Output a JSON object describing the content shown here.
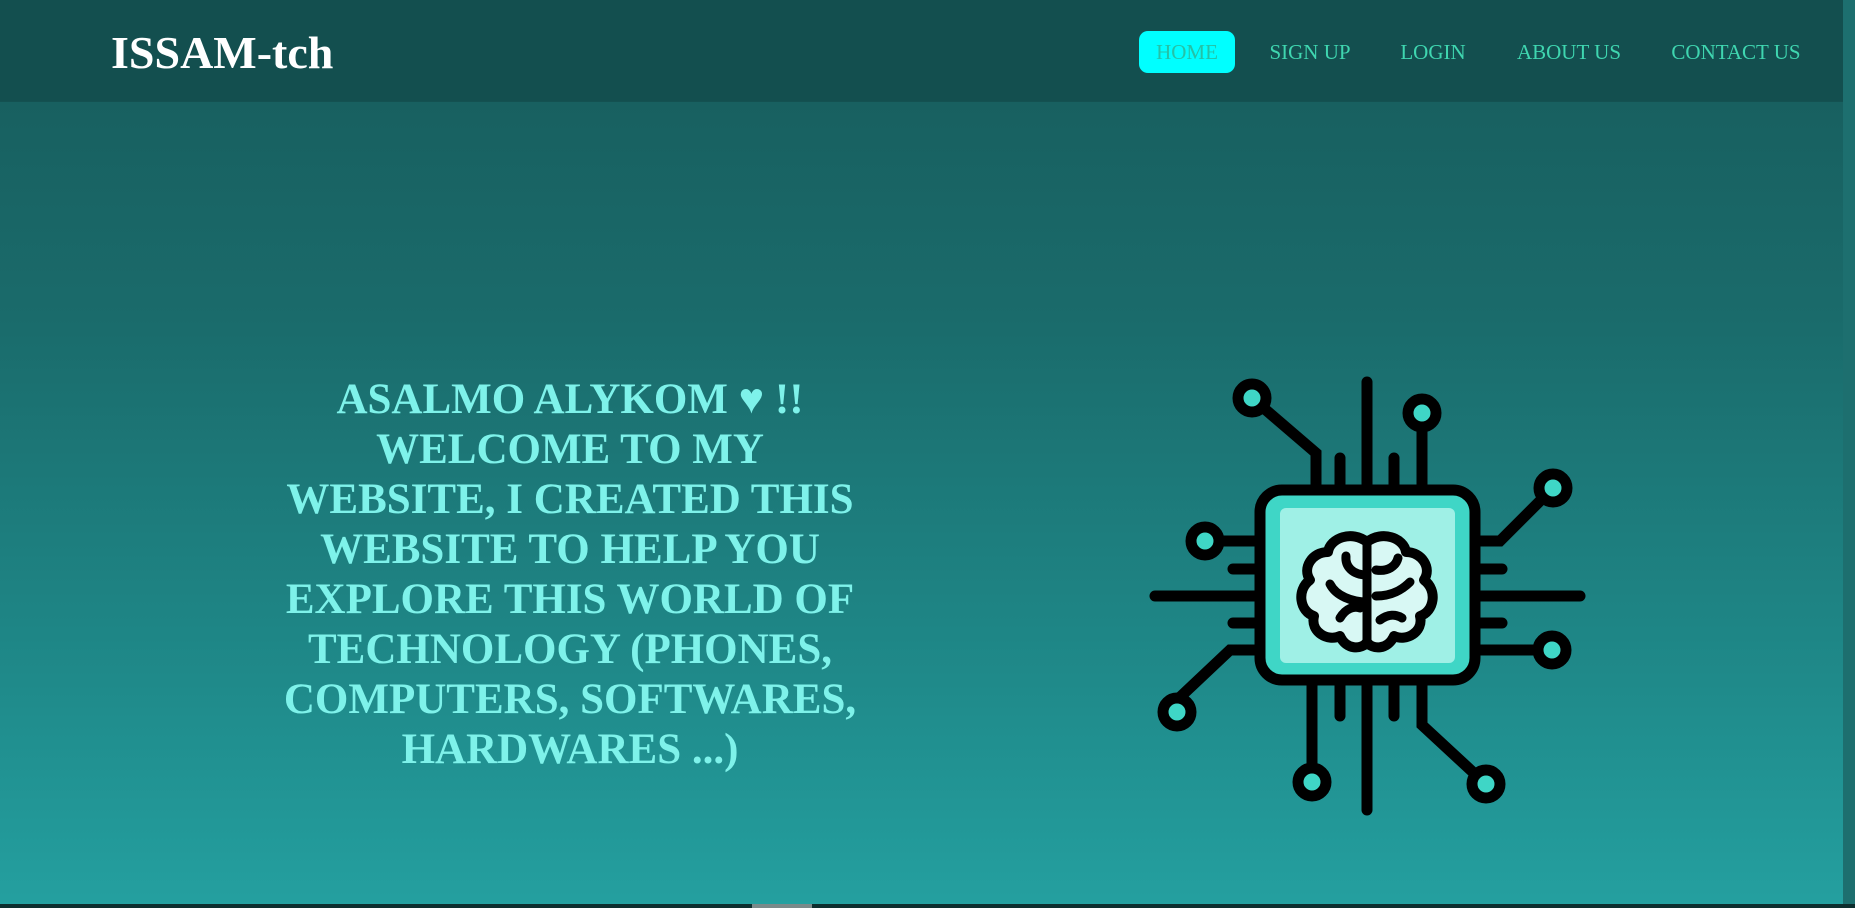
{
  "brand": {
    "title": "ISSAM-tch"
  },
  "nav": {
    "items": [
      {
        "label": "HOME",
        "active": true
      },
      {
        "label": "SIGN UP",
        "active": false
      },
      {
        "label": "LOGIN",
        "active": false
      },
      {
        "label": "ABOUT US",
        "active": false
      },
      {
        "label": "CONTACT US",
        "active": false
      }
    ]
  },
  "hero": {
    "line_start": "ASALMO ALYKOM",
    "heart": "♥",
    "line_rest": "!! WELCOME TO MY WEBSITE, I CREATED THIS WEBSITE TO HELP YOU EXPLORE THIS WORLD OF TECHNOLOGY (PHONES, COMPUTERS, SOFTWARES, HARDWARES ...)",
    "illustration_icon": "brain-chip-icon"
  },
  "colors": {
    "navbar_bg": "#134f4f",
    "active_pill": "#00ffff",
    "nav_text": "#3fd6b0",
    "hero_text": "#7ef2ea",
    "chip_fill": "#3fd6c6"
  }
}
